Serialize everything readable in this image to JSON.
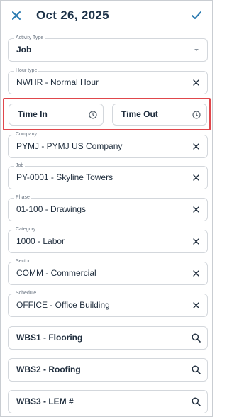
{
  "header": {
    "title": "Oct 26, 2025",
    "close_icon": "close-icon",
    "confirm_icon": "check-icon"
  },
  "fields": {
    "activity_type": {
      "label": "Activity Type",
      "value": "Job"
    },
    "hour_type": {
      "label": "Hour type",
      "value": "NWHR - Normal Hour"
    },
    "time_in": {
      "label": "Time In"
    },
    "time_out": {
      "label": "Time Out"
    },
    "company": {
      "label": "Company",
      "value": "PYMJ - PYMJ US Company"
    },
    "job": {
      "label": "Job",
      "value": "PY-0001 - Skyline Towers"
    },
    "phase": {
      "label": "Phase",
      "value": "01-100 - Drawings"
    },
    "category": {
      "label": "Category",
      "value": "1000 - Labor"
    },
    "sector": {
      "label": "Sector",
      "value": "COMM - Commercial"
    },
    "schedule": {
      "label": "Schedule",
      "value": "OFFICE - Office Building"
    },
    "wbs1": {
      "label": "WBS1 - Flooring"
    },
    "wbs2": {
      "label": "WBS2 - Roofing"
    },
    "wbs3": {
      "label": "WBS3 - LEM #"
    }
  },
  "colors": {
    "accent": "#2a7ab0",
    "title": "#1d3349",
    "highlight": "#e0474c",
    "border": "#d3d7dc"
  }
}
